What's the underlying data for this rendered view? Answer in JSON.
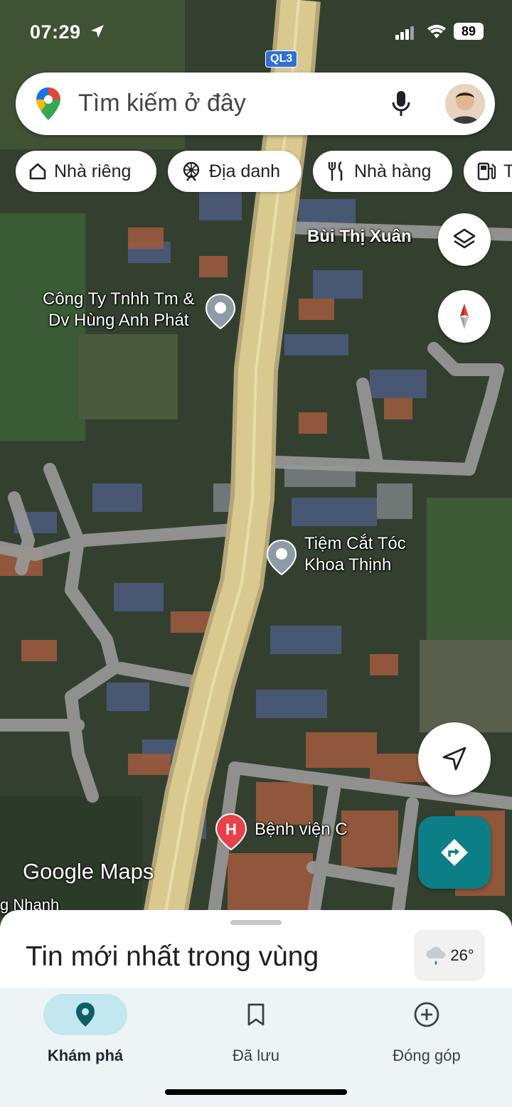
{
  "status_bar": {
    "time": "07:29",
    "battery": "89"
  },
  "map": {
    "route_shield": "QL3",
    "road_labels": [
      "Bùi Thị Xuân"
    ],
    "places": [
      {
        "name_line1": "Công Ty Tnhh Tm &",
        "name_line2": "Dv Hùng Anh Phát",
        "icon": "place-pin-icon"
      },
      {
        "name_line1": "Tiệm Cắt Tóc",
        "name_line2": "Khoa Thịnh",
        "icon": "place-pin-icon"
      },
      {
        "name_line1": "Bệnh viện C",
        "icon": "hospital-icon"
      }
    ],
    "edge_label": "g Nhanh",
    "watermark": "Google Maps"
  },
  "search": {
    "placeholder": "Tìm kiếm ở đây"
  },
  "chips": [
    {
      "label": "Nhà riêng",
      "icon": "home-icon"
    },
    {
      "label": "Địa danh",
      "icon": "landmark-icon"
    },
    {
      "label": "Nhà hàng",
      "icon": "restaurant-icon"
    },
    {
      "label": "Trạm xăng",
      "icon": "gas-station-icon"
    }
  ],
  "bottom_sheet": {
    "title": "Tin mới nhất trong vùng",
    "weather_temp": "26°"
  },
  "nav": [
    {
      "label": "Khám phá",
      "icon": "explore-pin-icon",
      "active": true
    },
    {
      "label": "Đã lưu",
      "icon": "bookmark-icon",
      "active": false
    },
    {
      "label": "Đóng góp",
      "icon": "add-circle-icon",
      "active": false
    }
  ],
  "colors": {
    "accent": "#0b7e86",
    "nav_active_bg": "#c2e7ee",
    "highway": "#d9c98e",
    "local_road": "#9a9a9a"
  }
}
